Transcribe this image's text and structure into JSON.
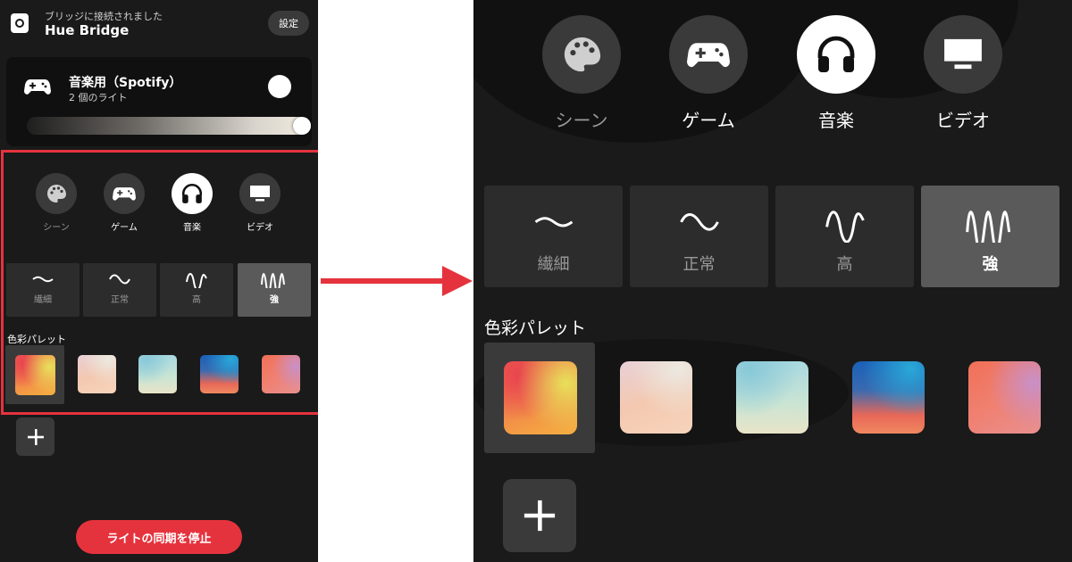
{
  "header": {
    "bridge_status": "ブリッジに接続されました",
    "bridge_name": "Hue Bridge",
    "settings_label": "設定"
  },
  "entertainment_area": {
    "name": "音楽用（Spotify）",
    "light_count": "2 個のライト",
    "brightness": 1.0,
    "on": true
  },
  "modes": [
    {
      "label": "シーン",
      "icon": "palette-icon"
    },
    {
      "label": "ゲーム",
      "icon": "gamepad-icon"
    },
    {
      "label": "音楽",
      "icon": "headphones-icon",
      "selected": true
    },
    {
      "label": "ビデオ",
      "icon": "monitor-icon"
    }
  ],
  "intensity": [
    {
      "label": "繊細",
      "icon": "wave-subtle-icon"
    },
    {
      "label": "正常",
      "icon": "wave-normal-icon"
    },
    {
      "label": "高",
      "icon": "wave-high-icon"
    },
    {
      "label": "強",
      "icon": "wave-strong-icon",
      "selected": true
    }
  ],
  "palette": {
    "title": "色彩パレット",
    "selected_index": 0,
    "swatches": [
      "warm-red-yellow",
      "pastel-peach",
      "aqua-cream",
      "blue-sunset",
      "coral-pink"
    ],
    "add_icon": "plus-icon"
  },
  "stop_button_label": "ライトの同期を停止",
  "colors": {
    "background": "#1a1a1a",
    "tile": "#3a3a3a",
    "highlight_border": "#e5333d",
    "stop_button": "#e5333d"
  }
}
